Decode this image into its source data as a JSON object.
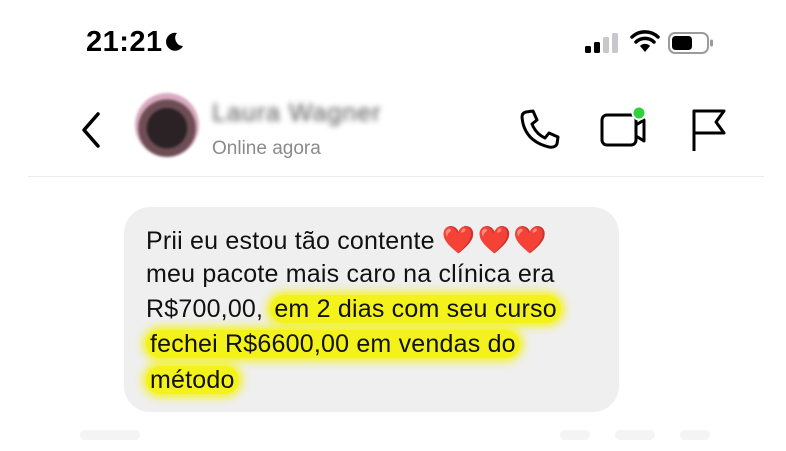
{
  "status_bar": {
    "time": "21:21",
    "icons": [
      "moon-icon",
      "cellular-signal-icon",
      "wifi-icon",
      "battery-icon"
    ]
  },
  "header": {
    "contact_name": "Laura Wagner",
    "status": "Online agora",
    "icons": [
      "back-icon",
      "phone-icon",
      "video-call-icon",
      "flag-icon"
    ],
    "active_dot_color": "#2fd13e"
  },
  "message": {
    "lines": [
      {
        "plain": "Prii eu estou tão contente ",
        "hearts": "❤️❤️❤️"
      },
      {
        "plain": "meu pacote mais caro na clínica era"
      },
      {
        "plain": "R$700,00, ",
        "highlight": "em 2 dias com seu curso"
      },
      {
        "highlight": "fechei R$6600,00 em vendas do"
      },
      {
        "highlight": "método"
      }
    ],
    "highlight_color": "#f3f21a",
    "bubble_color": "#efefef"
  }
}
